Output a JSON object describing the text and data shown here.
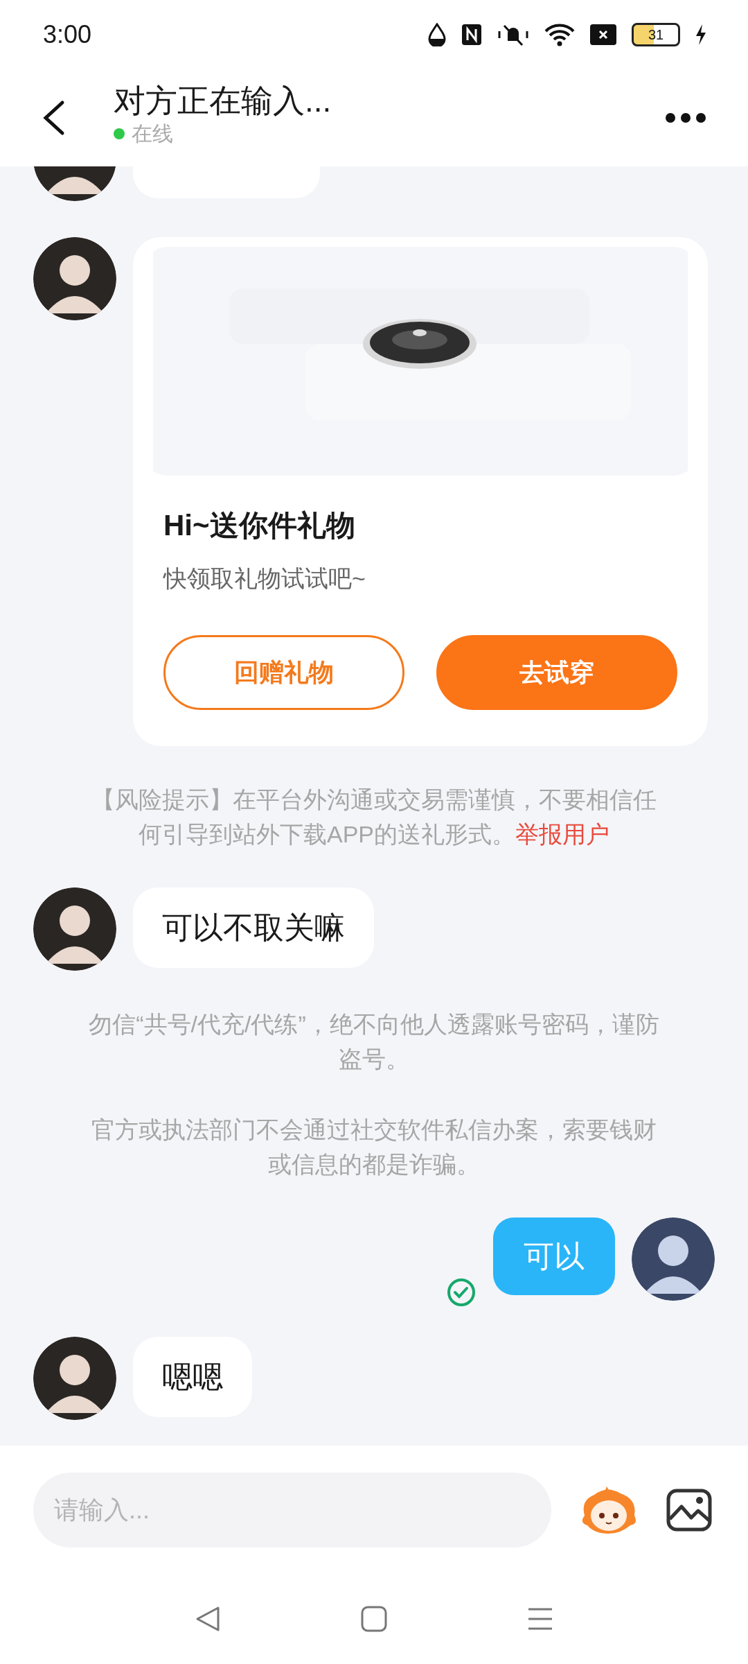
{
  "status_bar": {
    "time": "3:00",
    "battery": "31"
  },
  "header": {
    "title": "对方正在输入...",
    "presence": "在线",
    "online": true
  },
  "messages": [
    {
      "kind": "incoming_cut"
    },
    {
      "kind": "gift",
      "title": "Hi~送你件礼物",
      "subtitle": "快领取礼物试试吧~",
      "buttons": [
        {
          "label": "回赠礼物",
          "primary": false
        },
        {
          "label": "去试穿",
          "primary": true
        }
      ]
    },
    {
      "kind": "notice",
      "text": "【风险提示】在平台外沟通或交易需谨慎，不要相信任何引导到站外下载APP的送礼形式。",
      "link": "举报用户"
    },
    {
      "kind": "incoming",
      "text": "可以不取关嘛"
    },
    {
      "kind": "notice",
      "text": "勿信“共号/代充/代练”，绝不向他人透露账号密码，谨防盗号。"
    },
    {
      "kind": "notice",
      "text": "官方或执法部门不会通过社交软件私信办案，索要钱财或信息的都是诈骗。"
    },
    {
      "kind": "outgoing",
      "text": "可以",
      "read": true
    },
    {
      "kind": "incoming",
      "text": "嗯嗯"
    }
  ],
  "composer": {
    "placeholder": "请输入..."
  }
}
